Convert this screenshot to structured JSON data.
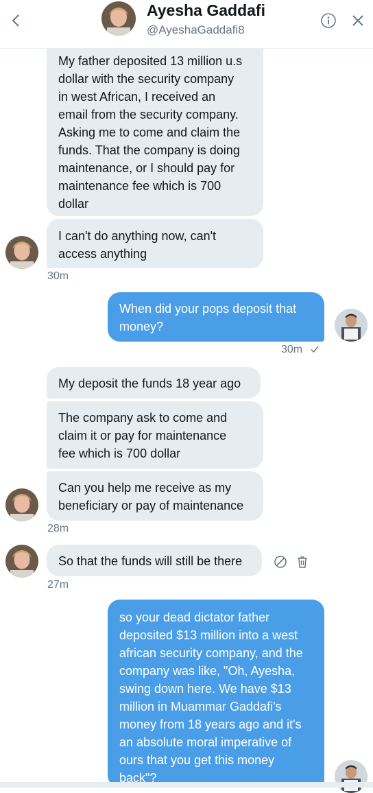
{
  "header": {
    "name": "Ayesha Gaddafi",
    "handle": "@AyeshaGaddafi8"
  },
  "icons": {
    "back": "chevron-left-icon",
    "info": "info-icon",
    "close": "close-icon",
    "delete": "trash-icon",
    "report": "block-icon",
    "sent_check": "checkmark-icon"
  },
  "colors": {
    "sent_bubble": "#4a9ee8",
    "received_bubble": "#e6ecf0",
    "muted_text": "#657786"
  },
  "messages": [
    {
      "text": "My father deposited 13 million u.s\ndollar with the security company\nin west African,  I received an\nemail from the security company.\nAsking me to come and claim the\nfunds. That the company is doing\nmaintenance,  or I should pay for\nmaintenance fee which is 700\ndollar"
    },
    {
      "text": "I can't do anything now,  can't\naccess anything"
    },
    {
      "text": "When did your pops deposit that\nmoney?"
    },
    {
      "text": "My deposit the funds 18 year ago"
    },
    {
      "text": "The company ask to come and\nclaim it or pay for maintenance\nfee which is 700 dollar"
    },
    {
      "text": "Can you help me receive as my\nbeneficiary or pay of maintenance"
    },
    {
      "text": "So that the funds will still be there"
    },
    {
      "text": "so your dead dictator father\ndeposited $13 million into a west\nafrican security company, and the\ncompany was like, \"Oh, Ayesha,\nswing down here. We have $13\nmillion in Muammar Gaddafi's\nmoney from 18 years ago and it's\nan absolute moral imperative of\nours that you get this money\nback\"?"
    }
  ],
  "timestamps": {
    "t1": "30m",
    "t2": "30m",
    "t3": "28m",
    "t4": "27m"
  }
}
